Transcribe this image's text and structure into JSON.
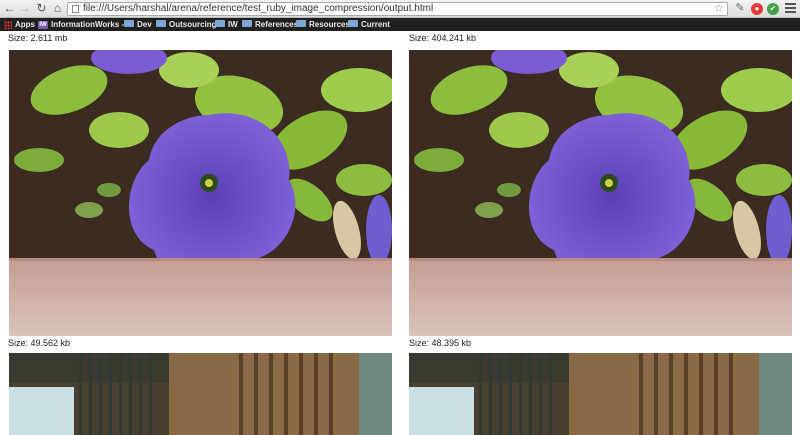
{
  "browser": {
    "url": "file:///Users/harshal/arena/reference/test_ruby_image_compression/output.html",
    "bookmarks": [
      {
        "label": "Apps"
      },
      {
        "label": "InformationWorks"
      },
      {
        "label": "Dev"
      },
      {
        "label": "Outsourcing"
      },
      {
        "label": "IW"
      },
      {
        "label": "References"
      },
      {
        "label": "Resources"
      },
      {
        "label": "Current"
      }
    ],
    "iw_badge": "IW",
    "iw_suffix": "-",
    "icons": {
      "back": "back-arrow-icon",
      "forward": "forward-arrow-icon",
      "reload": "reload-icon",
      "home": "home-icon",
      "star": "star-icon",
      "menu": "hamburger-menu-icon"
    }
  },
  "page": {
    "images": [
      {
        "size_label": "Size: 2.611 mb",
        "subject": "purple-petunia-photo"
      },
      {
        "size_label": "Size: 404.241 kb",
        "subject": "purple-petunia-photo"
      },
      {
        "size_label": "Size: 49.562 kb",
        "subject": "gate-photo"
      },
      {
        "size_label": "Size: 48.395 kb",
        "subject": "gate-photo"
      }
    ]
  },
  "colors": {
    "bookmark_bar": "#1f1f1f",
    "petal": "#7b5ad6",
    "leaf": "#8fbf3a",
    "soil": "#3a2a1e",
    "wall": "#c9a9a0"
  }
}
